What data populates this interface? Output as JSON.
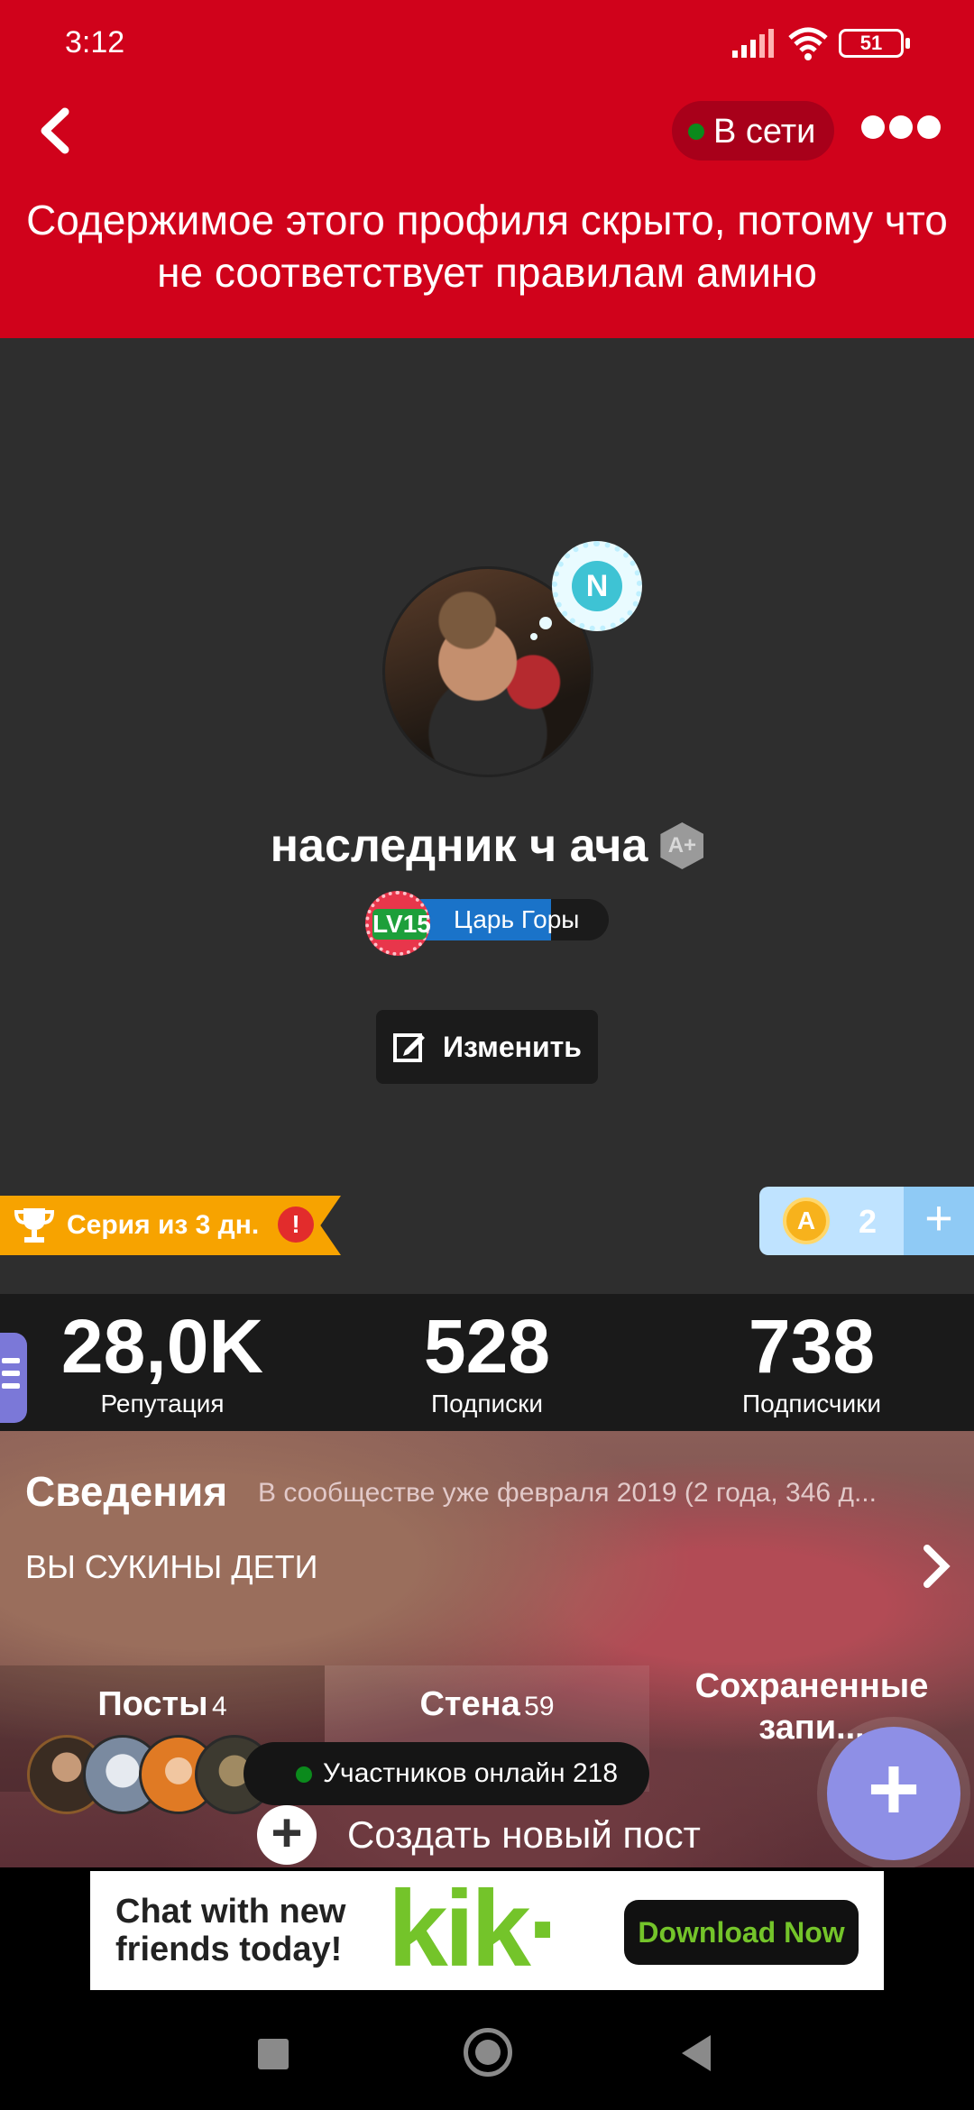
{
  "status_bar": {
    "time": "3:12",
    "battery": "51"
  },
  "header": {
    "online_label": "В сети"
  },
  "notice": "Содержимое этого профиля скрыто, потому что не соответствует правилам амино",
  "profile": {
    "avatar_bubble_letter": "N",
    "username": "наследник ч ача",
    "badge_letter": "A+",
    "level_badge": "LV15",
    "level_title": "Царь Горы",
    "level_progress": 0.72,
    "edit_label": "Изменить"
  },
  "streak": {
    "label": "Серия из 3 дн.",
    "warning": "!"
  },
  "coins": {
    "symbol": "A",
    "count": "2",
    "plus": "+"
  },
  "stats": [
    {
      "value": "28,0K",
      "label": "Репутация"
    },
    {
      "value": "528",
      "label": "Подписки"
    },
    {
      "value": "738",
      "label": "Подписчики"
    }
  ],
  "info": {
    "title": "Сведения",
    "subtitle": "В сообществе уже февраля 2019 (2 года, 346 д...",
    "description": "ВЫ СУКИНЫ ДЕТИ"
  },
  "tabs": [
    {
      "label": "Посты",
      "count": "4"
    },
    {
      "label": "Стена",
      "count": "59"
    },
    {
      "label": "Сохраненные запи..."
    }
  ],
  "online_members": {
    "label": "Участников онлайн 218"
  },
  "create_post": {
    "label": "Создать новый пост"
  },
  "ad": {
    "line1": "Chat with new",
    "line2": "friends today!",
    "brand": "kik·",
    "cta": "Download Now"
  },
  "colors": {
    "banner_red": "#d0021b",
    "streak_orange": "#f7a300",
    "level_blue": "#1a73c9",
    "fab_purple": "#8e8fe6",
    "kik_green": "#74c42a"
  }
}
